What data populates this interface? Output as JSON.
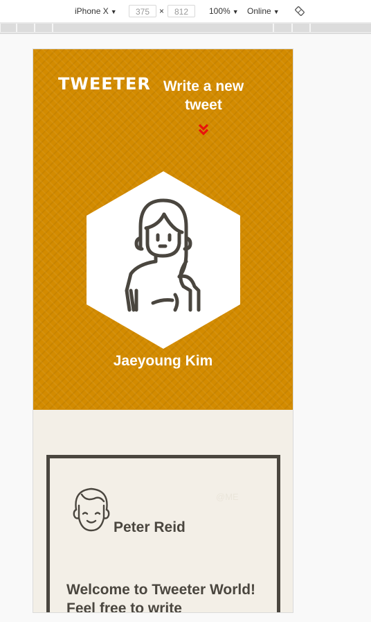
{
  "toolbar": {
    "device": "iPhone X",
    "width_value": "375",
    "height_value": "812",
    "dim_separator": "×",
    "zoom": "100%",
    "network": "Online",
    "caret": "▼"
  },
  "app": {
    "brand": "TWEETER",
    "write_link": "Write a new tweet",
    "profile_name": "Jaeyoung Kim",
    "accent_color": "#d38b00",
    "chevron_color": "#e8120c"
  },
  "tweet": {
    "author_name": "Peter Reid",
    "handle": "@ME",
    "text": "Welcome to Tweeter World! Feel free to write"
  }
}
